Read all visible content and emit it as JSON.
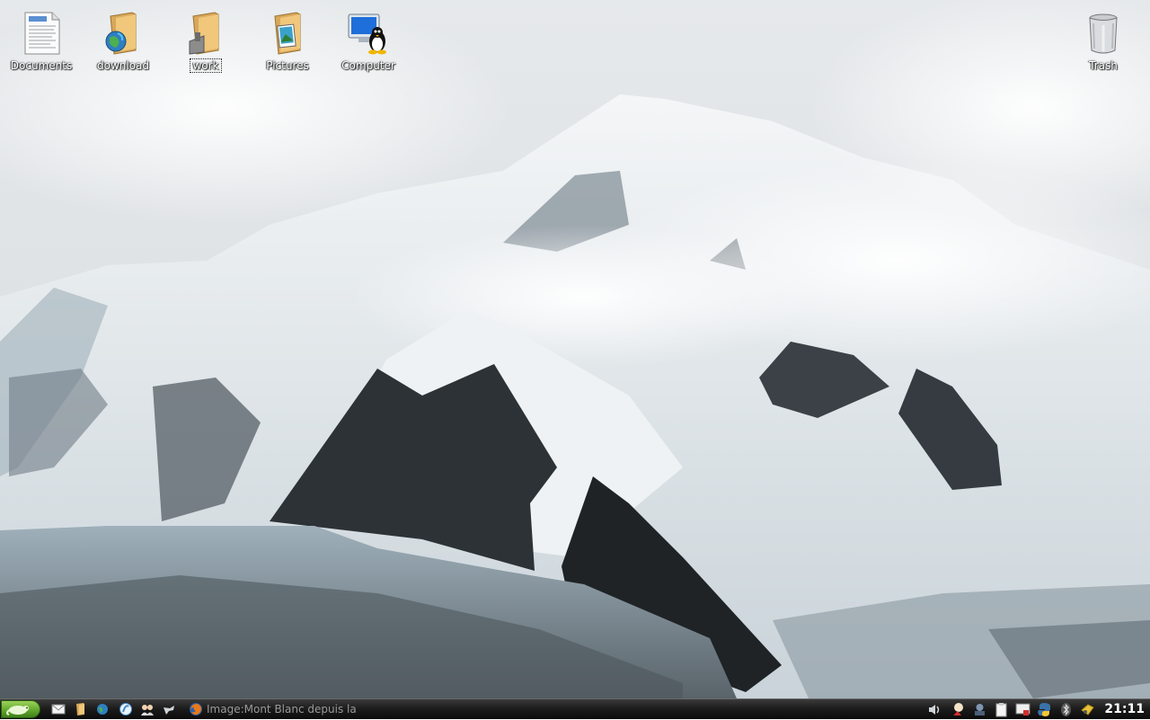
{
  "desktop": {
    "icons": [
      {
        "label": "Documents",
        "icon": "document-icon"
      },
      {
        "label": "download",
        "icon": "folder-globe-icon"
      },
      {
        "label": "work",
        "icon": "folder-icon",
        "selected": true
      },
      {
        "label": "Pictures",
        "icon": "folder-pictures-icon"
      },
      {
        "label": "Computer",
        "icon": "computer-tux-icon"
      },
      {
        "label": "Trash",
        "icon": "trash-icon"
      }
    ]
  },
  "taskbar": {
    "start_icon": "chameleon-menu-icon",
    "launchers": [
      "mail-icon",
      "file-manager-icon",
      "globe-browser-icon",
      "konqueror-icon",
      "people-icon",
      "tool-icon"
    ],
    "task": {
      "icon": "firefox-icon",
      "label": "Image:Mont Blanc depuis la"
    },
    "tray_icons": [
      "volume-icon",
      "update-icon",
      "network-icon",
      "clipboard-icon",
      "display-icon",
      "python-icon",
      "bluetooth-icon",
      "package-icon"
    ],
    "clock": "21:11"
  },
  "colors": {
    "start_green": "#5ea52a",
    "taskbar_bg": "#1a1a1a"
  }
}
